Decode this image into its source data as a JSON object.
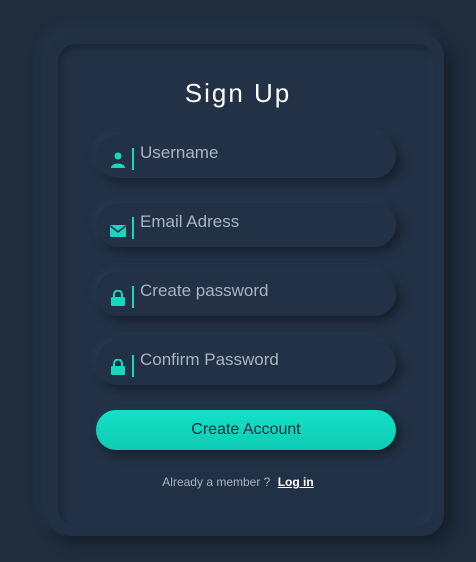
{
  "form": {
    "title": "Sign Up",
    "fields": [
      {
        "placeholder": "Username",
        "icon": "user-icon"
      },
      {
        "placeholder": "Email Adress",
        "icon": "envelope-icon"
      },
      {
        "placeholder": "Create password",
        "icon": "lock-icon"
      },
      {
        "placeholder": "Confirm Password",
        "icon": "lock-icon"
      }
    ],
    "submit_label": "Create Account",
    "member_text": "Already a member ?",
    "login_label": "Log in"
  },
  "colors": {
    "background": "#1f2d3d",
    "accent": "#16d8bf",
    "text": "#ffffff"
  }
}
